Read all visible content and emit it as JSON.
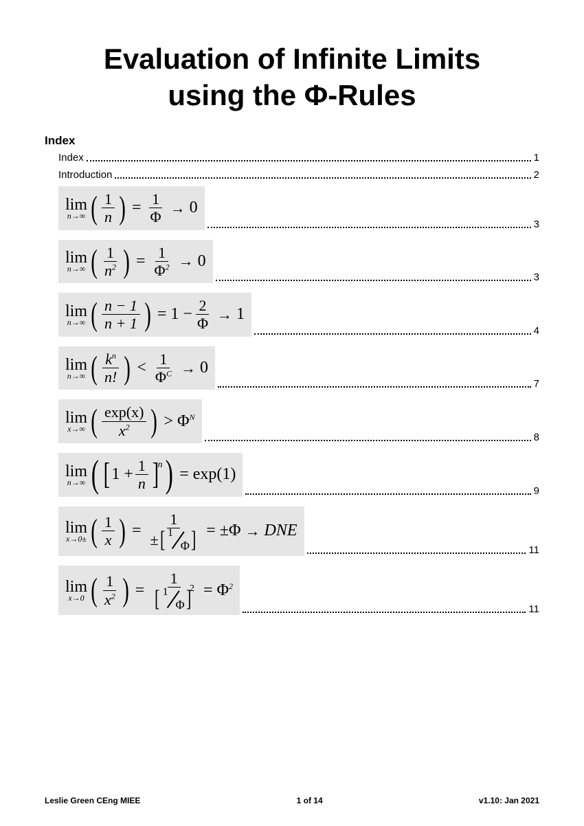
{
  "title_line1": "Evaluation of Infinite Limits",
  "title_line2": "using the Φ-Rules",
  "index_heading": "Index",
  "toc_text": [
    {
      "label": "Index",
      "page": "1"
    },
    {
      "label": "Introduction",
      "page": "2"
    }
  ],
  "toc_formulas": [
    {
      "page": "3"
    },
    {
      "page": "3"
    },
    {
      "page": "4"
    },
    {
      "page": "7"
    },
    {
      "page": "8"
    },
    {
      "page": "9"
    },
    {
      "page": "11"
    },
    {
      "page": "11"
    }
  ],
  "footer": {
    "author": "Leslie Green CEng MIEE",
    "page": "1 of 14",
    "version": "v1.10: Jan 2021"
  },
  "math": {
    "lim": "lim",
    "n_inf": "n→∞",
    "x_inf": "x→∞",
    "x_zero_pm": "x→0±",
    "x_zero": "x→0",
    "one": "1",
    "two": "2",
    "n": "n",
    "n2": "n",
    "phi": "Φ",
    "phi2_sup": "2",
    "nminus1": "n − 1",
    "nplus1": "n + 1",
    "oneminuslabel": "1 −",
    "kn_k": "k",
    "kn_n": "n",
    "nfact": "n!",
    "lt": "<",
    "gt": ">",
    "C": "C",
    "N": "N",
    "exp_x": "exp(x)",
    "x2": "x",
    "exp1": "exp(1)",
    "oneplus": "1 +",
    "pm": "±",
    "dne": "DNE",
    "eq": "=",
    "to0": "0",
    "to1": "1",
    "x": "x"
  }
}
